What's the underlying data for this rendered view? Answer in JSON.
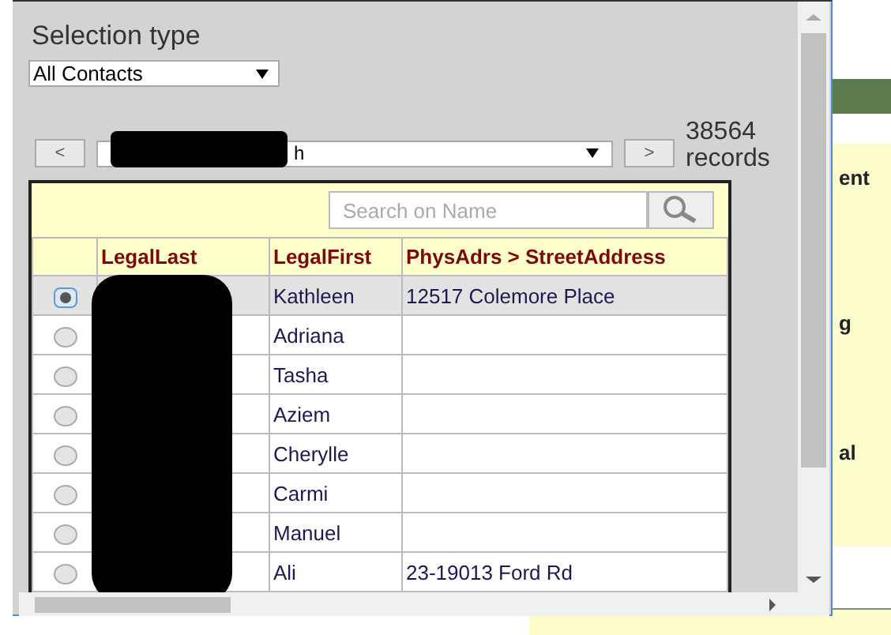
{
  "background_panel": {
    "labels": [
      "ent",
      "g",
      "al"
    ]
  },
  "dialog": {
    "title": "Selection type",
    "selection_type": {
      "value": "All Contacts"
    },
    "navigator": {
      "prev": "<",
      "next": ">",
      "value": "h",
      "record_count": "38564",
      "record_unit": "records"
    },
    "search": {
      "placeholder": "Search on Name"
    },
    "table": {
      "columns": [
        "LegalLast",
        "LegalFirst",
        "PhysAdrs > StreetAddress"
      ],
      "rows": [
        {
          "selected": true,
          "legal_last": "",
          "legal_first": "Kathleen",
          "street": "12517 Colemore Place"
        },
        {
          "selected": false,
          "legal_first": "Adriana",
          "street": ""
        },
        {
          "selected": false,
          "legal_first": "Tasha",
          "street": ""
        },
        {
          "selected": false,
          "legal_first": "Aziem",
          "street": ""
        },
        {
          "selected": false,
          "legal_first": "Cherylle",
          "street": ""
        },
        {
          "selected": false,
          "legal_first": "Carmi",
          "street": ""
        },
        {
          "selected": false,
          "legal_first": "Manuel",
          "street": ""
        },
        {
          "selected": false,
          "legal_first": "Ali",
          "street": "23-19013 Ford Rd"
        }
      ]
    }
  }
}
